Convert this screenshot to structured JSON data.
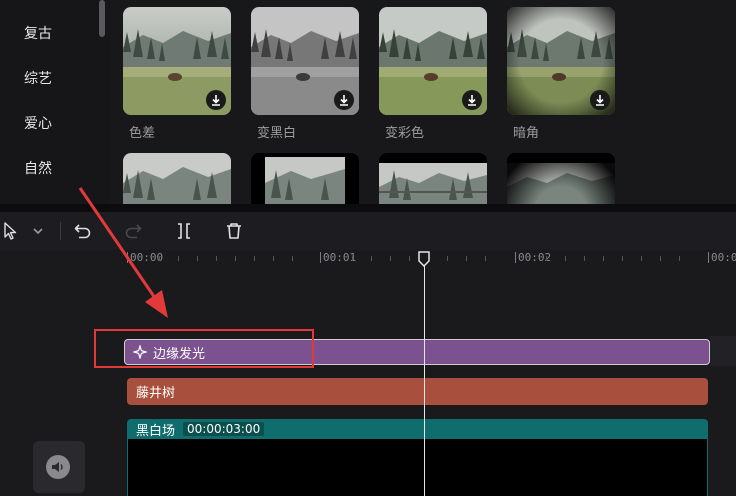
{
  "categories": [
    "复古",
    "综艺",
    "爱心",
    "自然"
  ],
  "effects": [
    {
      "label": "色差",
      "style": "color"
    },
    {
      "label": "变黑白",
      "style": "bw"
    },
    {
      "label": "变彩色",
      "style": "color"
    },
    {
      "label": "暗角",
      "style": "vignette"
    }
  ],
  "toolbar": {
    "icons": [
      "cursor-icon",
      "chevron-down-icon",
      "undo-icon",
      "redo-icon",
      "split-icon",
      "delete-icon"
    ]
  },
  "ruler": {
    "labels": [
      "00:00",
      "00:01",
      "00:02",
      "00:0"
    ]
  },
  "tracks": {
    "effect_clip": {
      "label": "边缘发光",
      "color": "#7b5190"
    },
    "filter_clip": {
      "label": "藤井树",
      "color": "#a8503d"
    },
    "video_clip": {
      "label": "黑白场",
      "duration": "00:00:03:00",
      "color": "#0f6d6d"
    }
  },
  "colors": {
    "annotation": "#e23a3a",
    "background": "#151518"
  }
}
